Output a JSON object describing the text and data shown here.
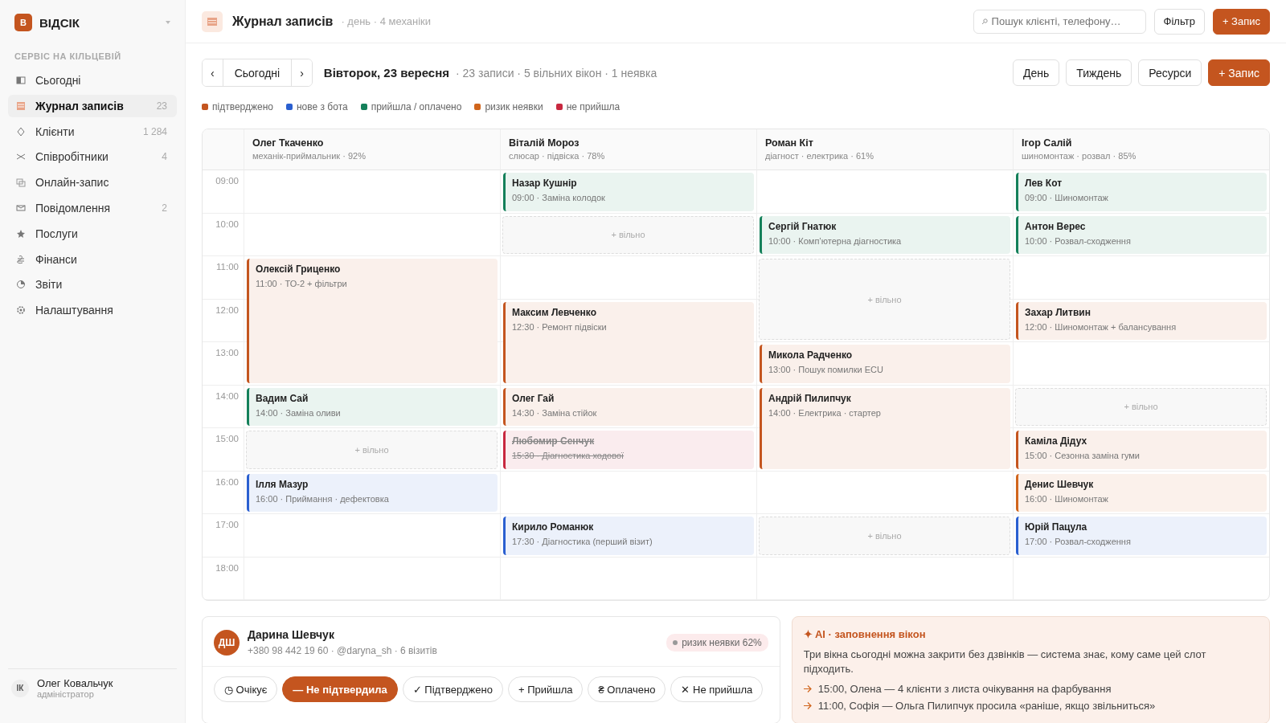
{
  "sidebar": {
    "logo": "В",
    "brand": "ВІДСІК",
    "section": "СЕРВІС НА КІЛЬЦЕВІЙ",
    "items": [
      {
        "label": "Сьогодні",
        "selected": false
      },
      {
        "label": "Журнал записів",
        "count": "23",
        "selected": true
      },
      {
        "label": "Клієнти",
        "count": "1 284",
        "selected": false
      },
      {
        "label": "Співробітники",
        "count": "4",
        "selected": false
      },
      {
        "label": "Онлайн-запис",
        "selected": false
      },
      {
        "label": "Повідомлення",
        "count": "2",
        "selected": false
      },
      {
        "label": "Послуги",
        "selected": false
      },
      {
        "label": "Фінанси",
        "selected": false
      },
      {
        "label": "Звіти",
        "selected": false
      },
      {
        "label": "Налаштування",
        "selected": false
      }
    ],
    "user": {
      "initials": "ІК",
      "name": "Олег Ковальчук",
      "role": "адміністратор"
    }
  },
  "header": {
    "title": "Журнал записів",
    "subtitle": "· день · 4 механіки",
    "search": {
      "placeholder": "Пошук клієнті, телефону…"
    },
    "filter": "Фільтр",
    "add": "+ Запис"
  },
  "toolbar": {
    "prev": "‹",
    "today": "Сьогодні",
    "next": "›",
    "date": "Вівторок, 23 вересня",
    "summary": "· 23 записи · 5 вільних вікон · 1 неявка",
    "views": [
      "День",
      "Тиждень",
      "Ресурси"
    ],
    "add": "+ Запис"
  },
  "legend": [
    {
      "label": "підтверджено",
      "color": "#c4551f"
    },
    {
      "label": "нове з бота",
      "color": "#2a5fd0"
    },
    {
      "label": "прийшла / оплачено",
      "color": "#14805a"
    },
    {
      "label": "ризик неявки",
      "color": "#d0651c"
    },
    {
      "label": "не прийшла",
      "color": "#c8283f"
    }
  ],
  "calendar": {
    "hours": [
      "09:00",
      "10:00",
      "11:00",
      "12:00",
      "13:00",
      "14:00",
      "15:00",
      "16:00",
      "17:00",
      "18:00"
    ],
    "mechanics": [
      {
        "name": "Олег Ткаченко",
        "role": "механік-приймальник · 92%",
        "events": [
          {
            "kind": "booking",
            "color": "#c4551f",
            "client": "Олексій Гриценко",
            "detail": "11:00 · ТО-2 + фільтри"
          },
          {
            "kind": "booking",
            "color": "#14805a",
            "client": "Вадим Сай",
            "detail": "14:00 · Заміна оливи"
          },
          {
            "kind": "free",
            "label": "+ вільно"
          },
          {
            "kind": "booking",
            "color": "#2a5fd0",
            "client": "Ілля Мазур",
            "detail": "16:00 · Приймання · дефектовка"
          }
        ]
      },
      {
        "name": "Віталій Мороз",
        "role": "слюсар · підвіска · 78%",
        "events": [
          {
            "kind": "booking",
            "color": "#14805a",
            "client": "Назар Кушнір",
            "detail": "09:00 · Заміна колодок"
          },
          {
            "kind": "free",
            "label": "+ вільно"
          },
          {
            "kind": "booking",
            "color": "#c4551f",
            "client": "Максим Левченко",
            "detail": "12:30 · Ремонт підвіски"
          },
          {
            "kind": "booking",
            "color": "#c4551f",
            "client": "Олег Гай",
            "detail": "14:30 · Заміна стійок"
          },
          {
            "kind": "cancelled",
            "color": "#c8283f",
            "client": "Любомир Сенчук",
            "detail": "15:30 · Діагностика ходової"
          },
          {
            "kind": "booking",
            "color": "#2a5fd0",
            "client": "Кирило Романюк",
            "detail": "17:30 · Діагностика (перший візит)"
          }
        ]
      },
      {
        "name": "Роман Кіт",
        "role": "діагност · електрика · 61%",
        "events": [
          {
            "kind": "booking",
            "color": "#14805a",
            "client": "Сергій Гнатюк",
            "detail": "10:00 · Комп’ютерна діагностика"
          },
          {
            "kind": "free",
            "label": "+ вільно"
          },
          {
            "kind": "booking",
            "color": "#c4551f",
            "client": "Микола Радченко",
            "detail": "13:00 · Пошук помилки ECU"
          },
          {
            "kind": "booking",
            "color": "#c4551f",
            "client": "Андрій Пилипчук",
            "detail": "14:00 · Електрика · стартер"
          },
          {
            "kind": "free",
            "label": "+ вільно"
          }
        ]
      },
      {
        "name": "Ігор Салій",
        "role": "шиномонтаж · розвал · 85%",
        "events": [
          {
            "kind": "booking",
            "color": "#14805a",
            "client": "Лев Кот",
            "detail": "09:00 · Шиномонтаж"
          },
          {
            "kind": "booking",
            "color": "#14805a",
            "client": "Антон Верес",
            "detail": "10:00 · Розвал-сходження"
          },
          {
            "kind": "booking",
            "color": "#c4551f",
            "client": "Захар Литвин",
            "detail": "12:00 · Шиномонтаж + балансування"
          },
          {
            "kind": "free",
            "label": "+ вільно"
          },
          {
            "kind": "booking",
            "color": "#c4551f",
            "client": "Каміла Дідух",
            "detail": "15:00 · Сезонна заміна гуми"
          },
          {
            "kind": "booking",
            "color": "#d0651c",
            "client": "Денис Шевчук",
            "detail": "16:00 · Шиномонтаж"
          },
          {
            "kind": "booking",
            "color": "#2a5fd0",
            "client": "Юрій Пацула",
            "detail": "17:00 · Розвал-сходження"
          }
        ]
      }
    ]
  },
  "client": {
    "initials": "ДШ",
    "name": "Дарина Шевчук",
    "contacts": "+380 98 442 19 60 · @daryna_sh · 6 візитів",
    "risk": "ризик неявки 62%",
    "statuses": [
      {
        "label": "◷ Очікує",
        "selected": false
      },
      {
        "label": "— Не підтвердила",
        "selected": true
      },
      {
        "label": "✓ Підтверджено",
        "selected": false
      },
      {
        "label": "+ Прийшла",
        "selected": false
      },
      {
        "label": "₴ Оплачено",
        "selected": false
      },
      {
        "label": "✕ Не прийшла",
        "selected": false
      }
    ]
  },
  "ai": {
    "title": "✦ AI · заповнення вікон",
    "text": "Три вікна сьогодні можна закрити без дзвінків — система знає, кому саме цей слот підходить.",
    "suggestions": [
      "15:00, Олена — 4 клієнти з листа очікування на фарбування",
      "11:00, Софія — Ольга Пилипчук просила «раніше, якщо звільниться»"
    ]
  }
}
